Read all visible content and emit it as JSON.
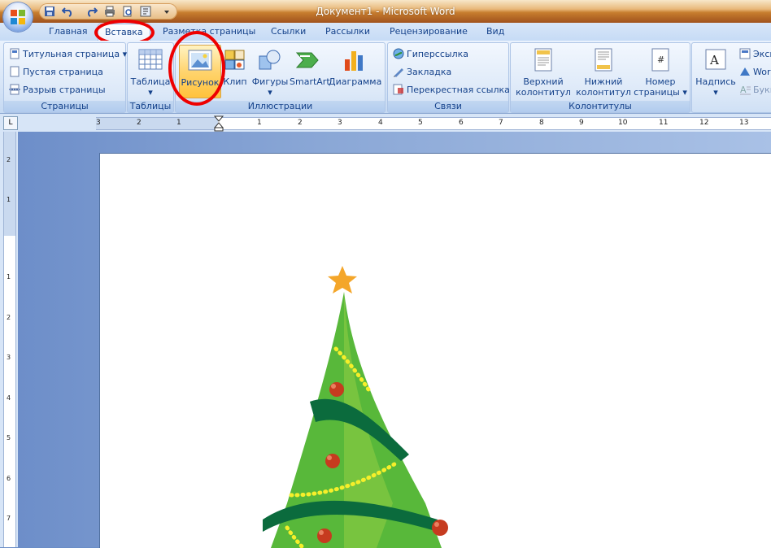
{
  "window": {
    "title": "Документ1 - Microsoft Word"
  },
  "tabs": [
    "Главная",
    "Вставка",
    "Разметка страницы",
    "Ссылки",
    "Рассылки",
    "Рецензирование",
    "Вид"
  ],
  "groups": {
    "pages": {
      "label": "Страницы",
      "items": [
        "Титульная страница",
        "Пустая страница",
        "Разрыв страницы"
      ]
    },
    "tables": {
      "label": "Таблицы",
      "button": "Таблица"
    },
    "illustrations": {
      "label": "Иллюстрации",
      "buttons": [
        "Рисунок",
        "Клип",
        "Фигуры",
        "SmartArt",
        "Диаграмма"
      ]
    },
    "links": {
      "label": "Связи",
      "items": [
        "Гиперссылка",
        "Закладка",
        "Перекрестная ссылка"
      ]
    },
    "headers": {
      "label": "Колонтитулы",
      "buttons": [
        {
          "l1": "Верхний",
          "l2": "колонтитул"
        },
        {
          "l1": "Нижний",
          "l2": "колонтитул"
        },
        {
          "l1": "Номер",
          "l2": "страницы"
        }
      ]
    },
    "text": {
      "button": "Надпись",
      "items": [
        "Эксп",
        "Wor",
        "Букв"
      ]
    }
  },
  "ruler": {
    "corner": "L",
    "h_numbers": [
      "3",
      "2",
      "1",
      "1",
      "2",
      "3",
      "4",
      "5",
      "6",
      "7",
      "8",
      "9",
      "10",
      "11",
      "12",
      "13"
    ],
    "v_numbers": [
      "2",
      "1",
      "1",
      "2",
      "3",
      "4",
      "5",
      "6",
      "7"
    ]
  },
  "colors": {
    "annotation": "#e00000",
    "ribbon": "#d7e5f7",
    "title_bar": "#c77d2f"
  }
}
